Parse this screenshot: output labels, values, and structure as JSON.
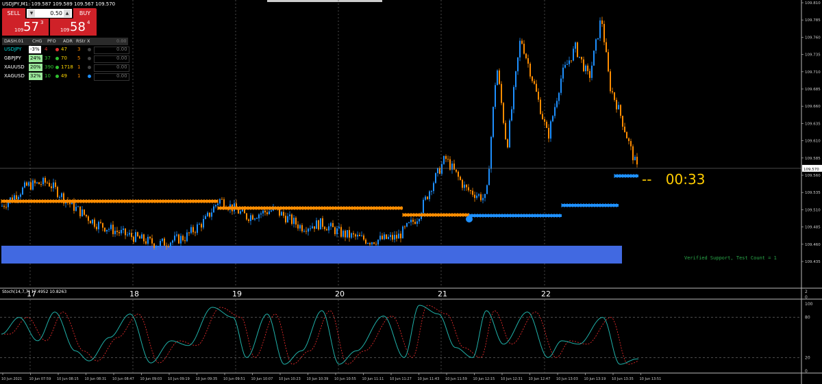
{
  "window": {
    "title": "USDJPY,M1: 109.587 109.589 109.567 109.570"
  },
  "trade_panel": {
    "sell_label": "SELL",
    "buy_label": "BUY",
    "lot": "0.50",
    "sell_prefix": "109",
    "sell_big": "57",
    "sell_pip": "3",
    "buy_prefix": "109",
    "buy_big": "58",
    "buy_pip": "4"
  },
  "dashboard": {
    "name": "DASH.01",
    "headers": [
      "CHG",
      "PFO",
      "ADR",
      "RStr",
      "X"
    ],
    "header_value": "0.00",
    "rows": [
      {
        "symbol": "USDJPY",
        "chg": "-3%",
        "pfo": "4",
        "adr": "47",
        "rstr": "3",
        "value": "0.00"
      },
      {
        "symbol": "GBPJPY",
        "chg": "24%",
        "pfo": "37",
        "adr": "70",
        "rstr": "5",
        "value": "0.00"
      },
      {
        "symbol": "XAUUSD",
        "chg": "20%",
        "pfo": "390",
        "adr": "1718",
        "rstr": "1",
        "value": "0.00"
      },
      {
        "symbol": "XAGUSD",
        "chg": "32%",
        "pfo": "10",
        "adr": "49",
        "rstr": "1",
        "value": "0.00"
      }
    ]
  },
  "price_axis": [
    "109.810",
    "109.785",
    "109.760",
    "109.735",
    "109.710",
    "109.685",
    "109.660",
    "109.635",
    "109.610",
    "109.585",
    "109.560",
    "109.535",
    "109.510",
    "109.485",
    "109.460",
    "109.435"
  ],
  "current_price": "109.570",
  "date_axis": [
    "17",
    "18",
    "19",
    "20",
    "21",
    "22"
  ],
  "timer": {
    "dash": "--",
    "value": "00:33"
  },
  "support_label": "Verified Support, Test Count = 1",
  "mid_axis": [
    "2",
    "0"
  ],
  "stoch": {
    "label": "Stoch(14,7,7) 17.4952 10.8263",
    "levels": [
      "100",
      "80",
      "20",
      "0"
    ]
  },
  "time_axis": [
    "10 Jun 2021",
    "10 Jun 07:59",
    "10 Jun 08:15",
    "10 Jun 08:31",
    "10 Jun 08:47",
    "10 Jun 09:03",
    "10 Jun 09:19",
    "10 Jun 09:35",
    "10 Jun 09:51",
    "10 Jun 10:07",
    "10 Jun 10:23",
    "10 Jun 10:39",
    "10 Jun 10:55",
    "10 Jun 11:11",
    "10 Jun 11:27",
    "10 Jun 11:43",
    "10 Jun 11:59",
    "10 Jun 12:15",
    "10 Jun 12:31",
    "10 Jun 12:47",
    "10 Jun 13:03",
    "10 Jun 13:19",
    "10 Jun 13:35",
    "10 Jun 13:51"
  ],
  "colors": {
    "bull": "#1e90ff",
    "bear": "#ff8c00",
    "zone": "#4169e1",
    "timer": "#ffcc00",
    "support_text": "#2aa84a",
    "stoch_main": "#20b2aa",
    "stoch_signal": "#ff3030"
  }
}
